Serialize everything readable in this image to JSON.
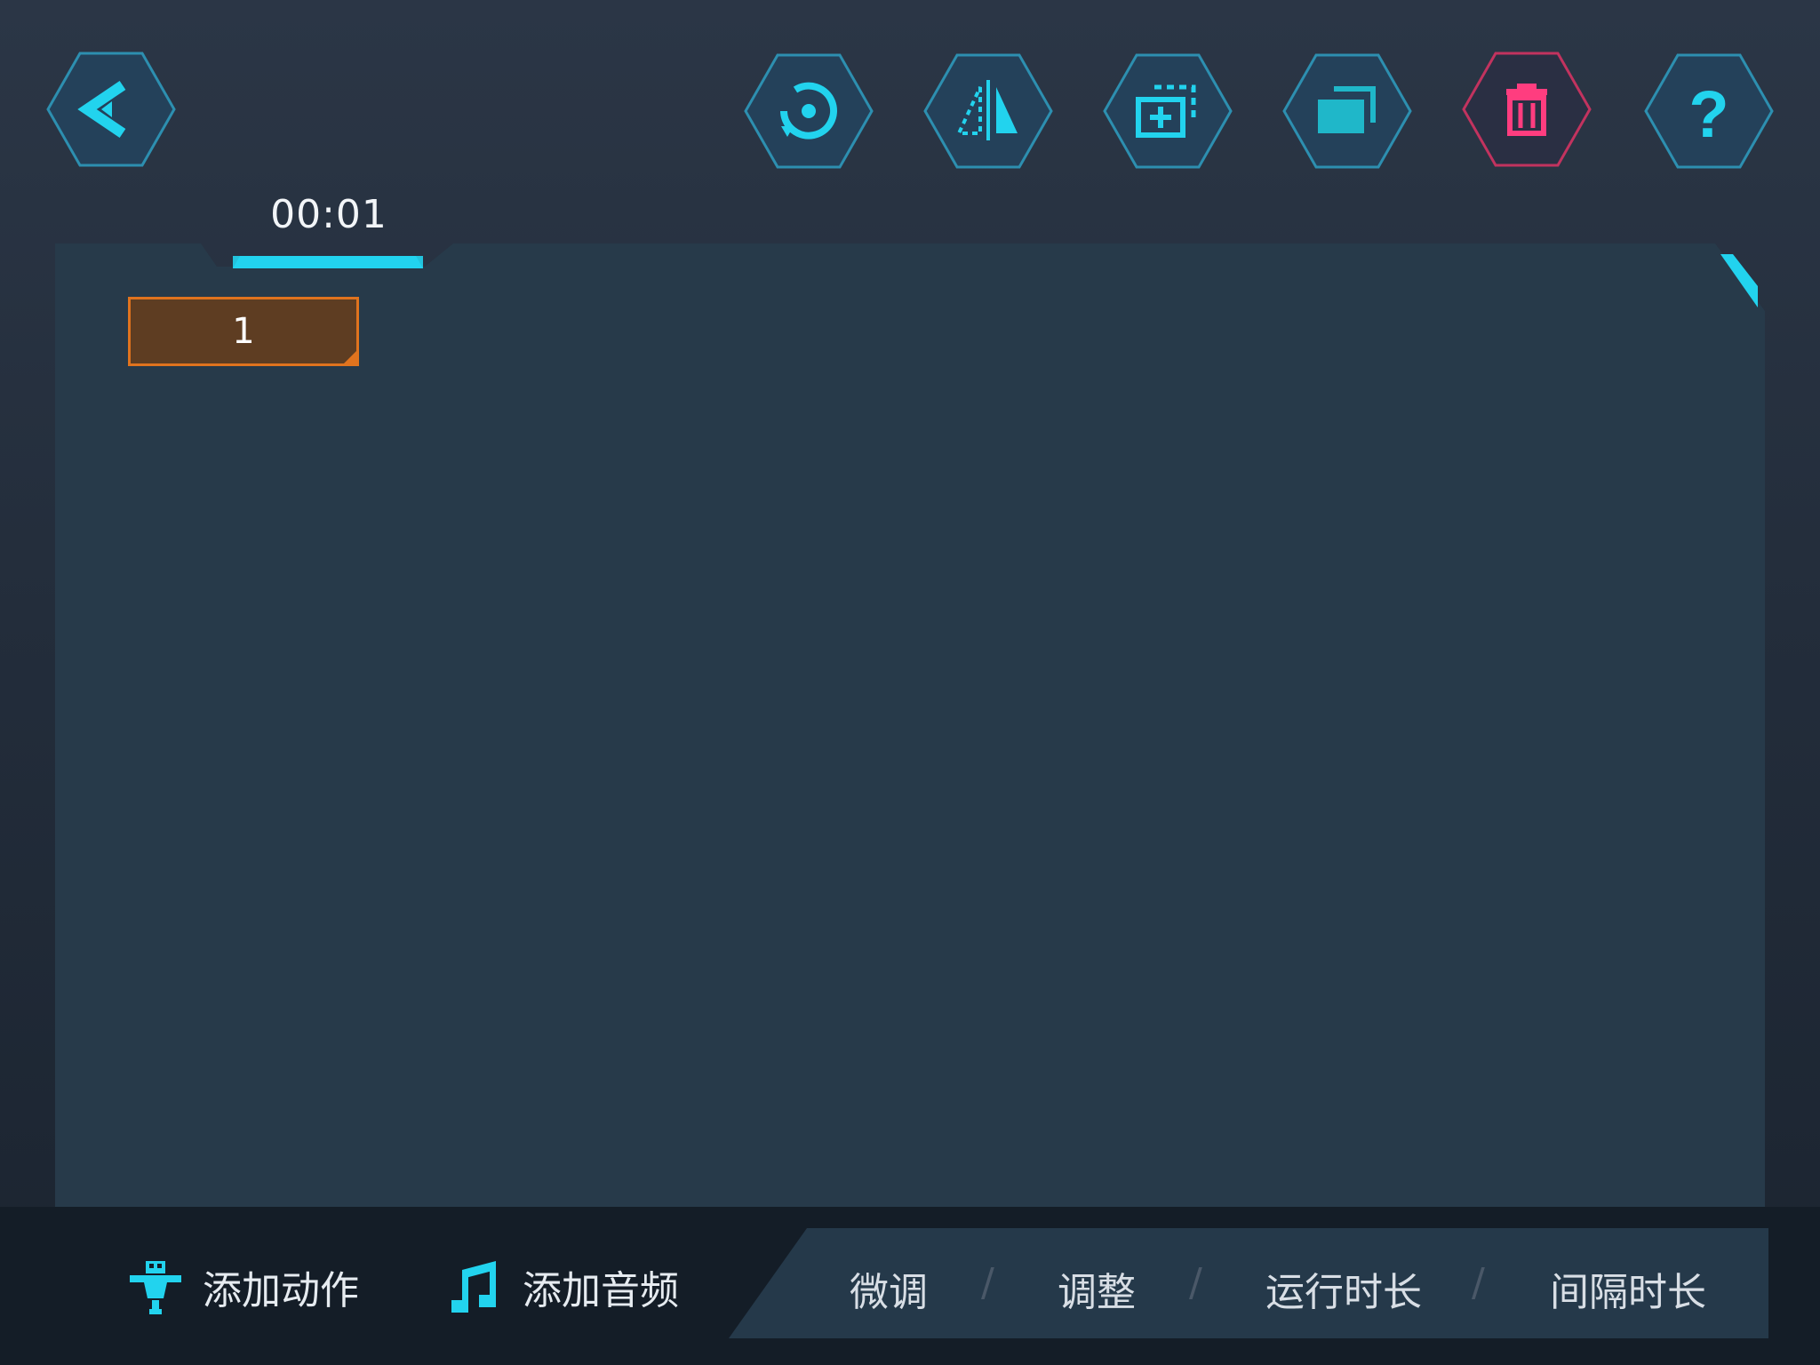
{
  "toolbar": {
    "back": {
      "icon": "back-arrow-icon"
    },
    "reset": {
      "icon": "rotate-reset-icon"
    },
    "mirror": {
      "icon": "mirror-flip-icon"
    },
    "add_frame": {
      "icon": "add-frame-icon"
    },
    "copy": {
      "icon": "copy-icon"
    },
    "delete": {
      "icon": "trash-icon"
    },
    "help": {
      "icon": "help-icon",
      "glyph": "?"
    }
  },
  "timeline": {
    "current_time": "00:01",
    "frames": [
      {
        "label": "1"
      }
    ]
  },
  "bottom": {
    "add_action": {
      "label": "添加动作",
      "icon": "robot-icon"
    },
    "add_audio": {
      "label": "添加音频",
      "icon": "music-note-icon"
    },
    "tabs": [
      {
        "label": "微调"
      },
      {
        "label": "调整"
      },
      {
        "label": "运行时长"
      },
      {
        "label": "间隔时长"
      }
    ],
    "separator": "/"
  },
  "colors": {
    "accent": "#22d3ee",
    "danger": "#ff3d7f",
    "frame_fill": "#5e3d22",
    "frame_border": "#e0731e",
    "panel": "#273a4a"
  }
}
